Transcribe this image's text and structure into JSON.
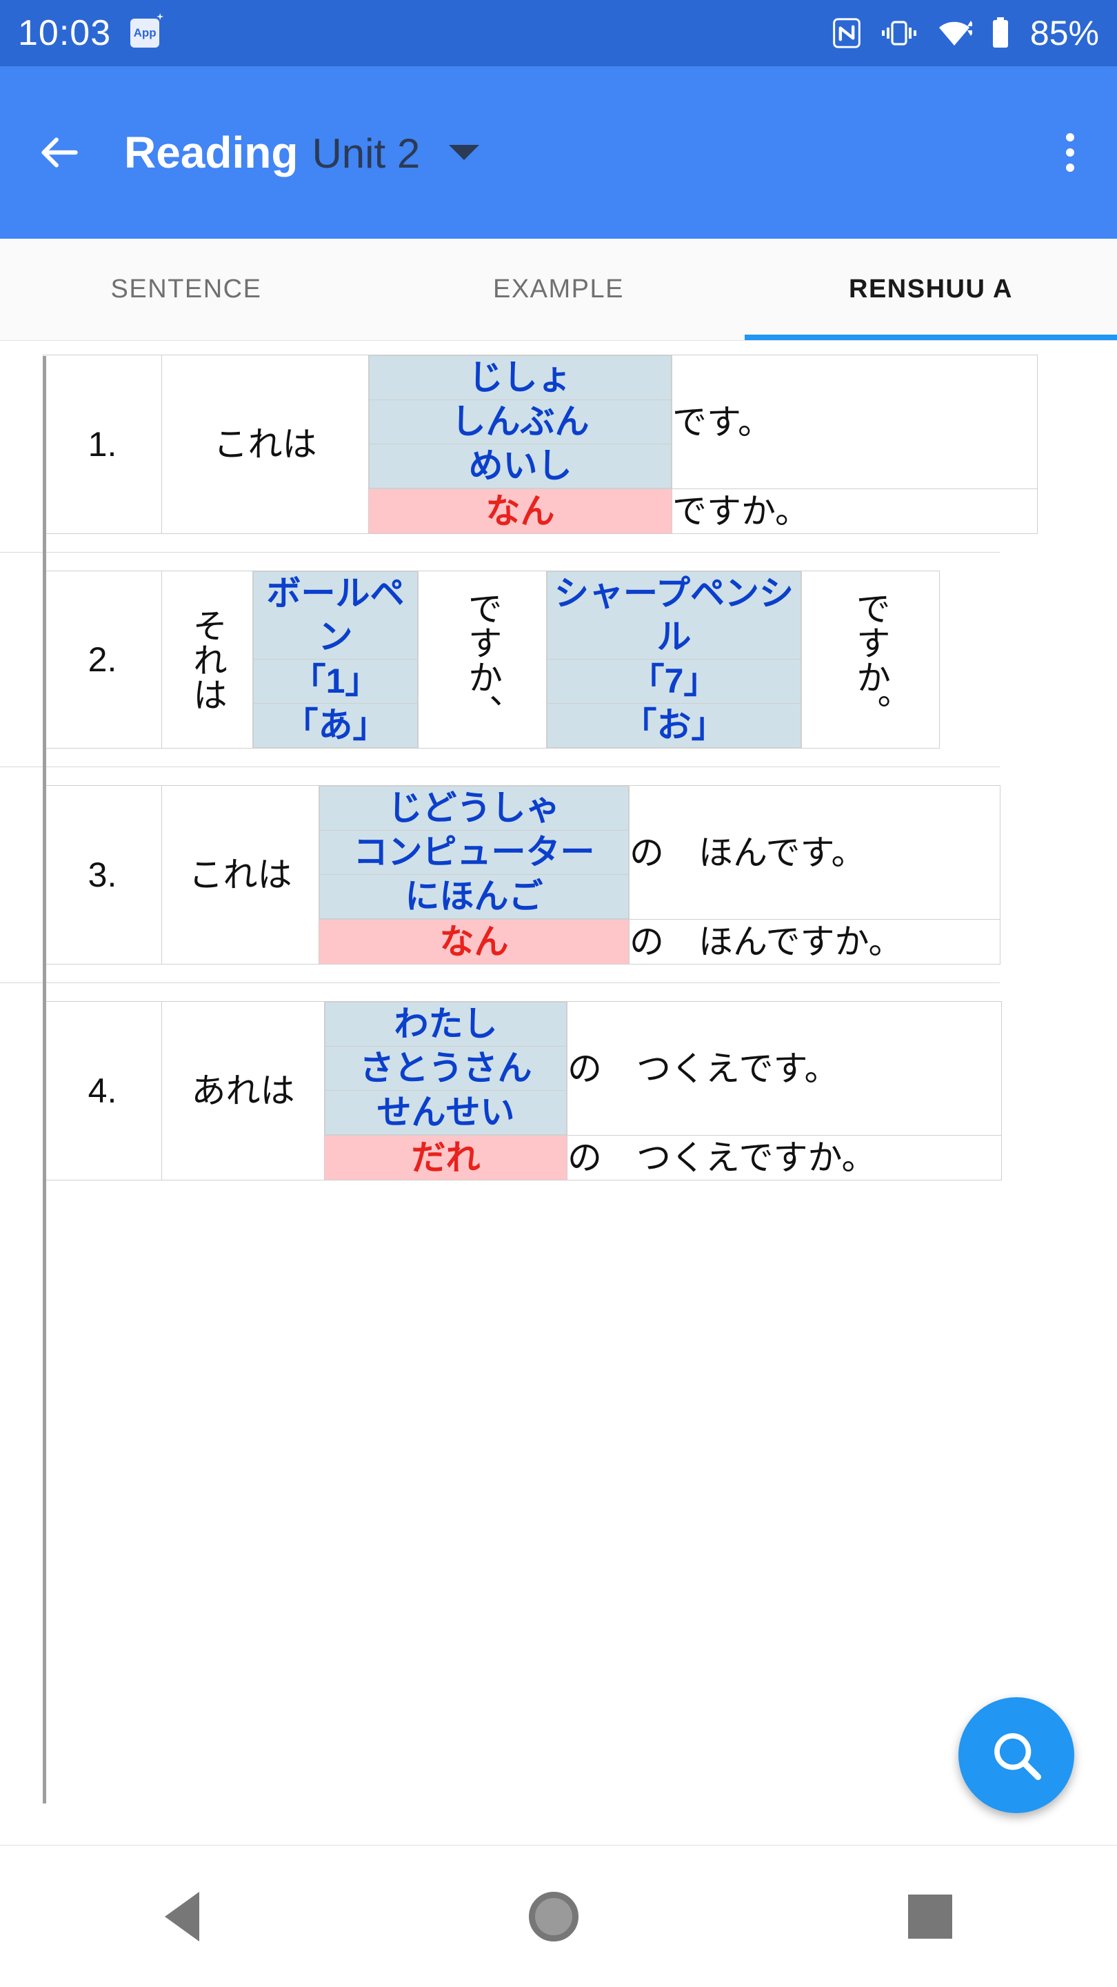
{
  "status_bar": {
    "time": "10:03",
    "app_badge_label": "App",
    "icons": [
      "nfc-icon",
      "vibrate-icon",
      "wifi-icon",
      "battery-icon"
    ],
    "battery": "85%"
  },
  "app_bar": {
    "back_label": "back-arrow",
    "title": "Reading",
    "subtitle": "Unit 2",
    "dropdown": "unit-dropdown",
    "overflow": "more-options"
  },
  "tabs": [
    {
      "label": "SENTENCE",
      "active": false
    },
    {
      "label": "EXAMPLE",
      "active": false
    },
    {
      "label": "RENSHUU A",
      "active": true
    }
  ],
  "exercises": [
    {
      "number": "1.",
      "lead": "これは",
      "blue_options": [
        "じしょ",
        "しんぶん",
        "めいし"
      ],
      "blue_tail": "です。",
      "pink_option": "なん",
      "pink_tail": "ですか。"
    },
    {
      "number": "2.",
      "lead": "それは",
      "blue_options_1": [
        "ボールペン",
        "「1」",
        "「あ」"
      ],
      "mid": "ですか、",
      "blue_options_2": [
        "シャープペンシル",
        "「7」",
        "「お」"
      ],
      "tail": "ですか。"
    },
    {
      "number": "3.",
      "lead": "これは",
      "blue_options": [
        "じどうしゃ",
        "コンピューター",
        "にほんご"
      ],
      "blue_tail": "の　ほんです。",
      "pink_option": "なん",
      "pink_tail": "の　ほんですか。"
    },
    {
      "number": "4.",
      "lead": "あれは",
      "blue_options": [
        "わたし",
        "さとうさん",
        "せんせい"
      ],
      "blue_tail": "の　つくえです。",
      "pink_option": "だれ",
      "pink_tail": "の　つくえですか。"
    }
  ],
  "fab": {
    "name": "search-fab"
  },
  "nav_bar": {
    "back": "back-triangle",
    "home": "home-circle",
    "recents": "recents-square"
  },
  "colors": {
    "status_bar": "#2c68d4",
    "app_bar": "#4285f4",
    "accent": "#2196f3",
    "blue_option_bg": "#cfe0e8",
    "blue_option_text": "#0b3fcc",
    "pink_option_bg": "#ffc6ca",
    "pink_option_text": "#e8221c"
  }
}
